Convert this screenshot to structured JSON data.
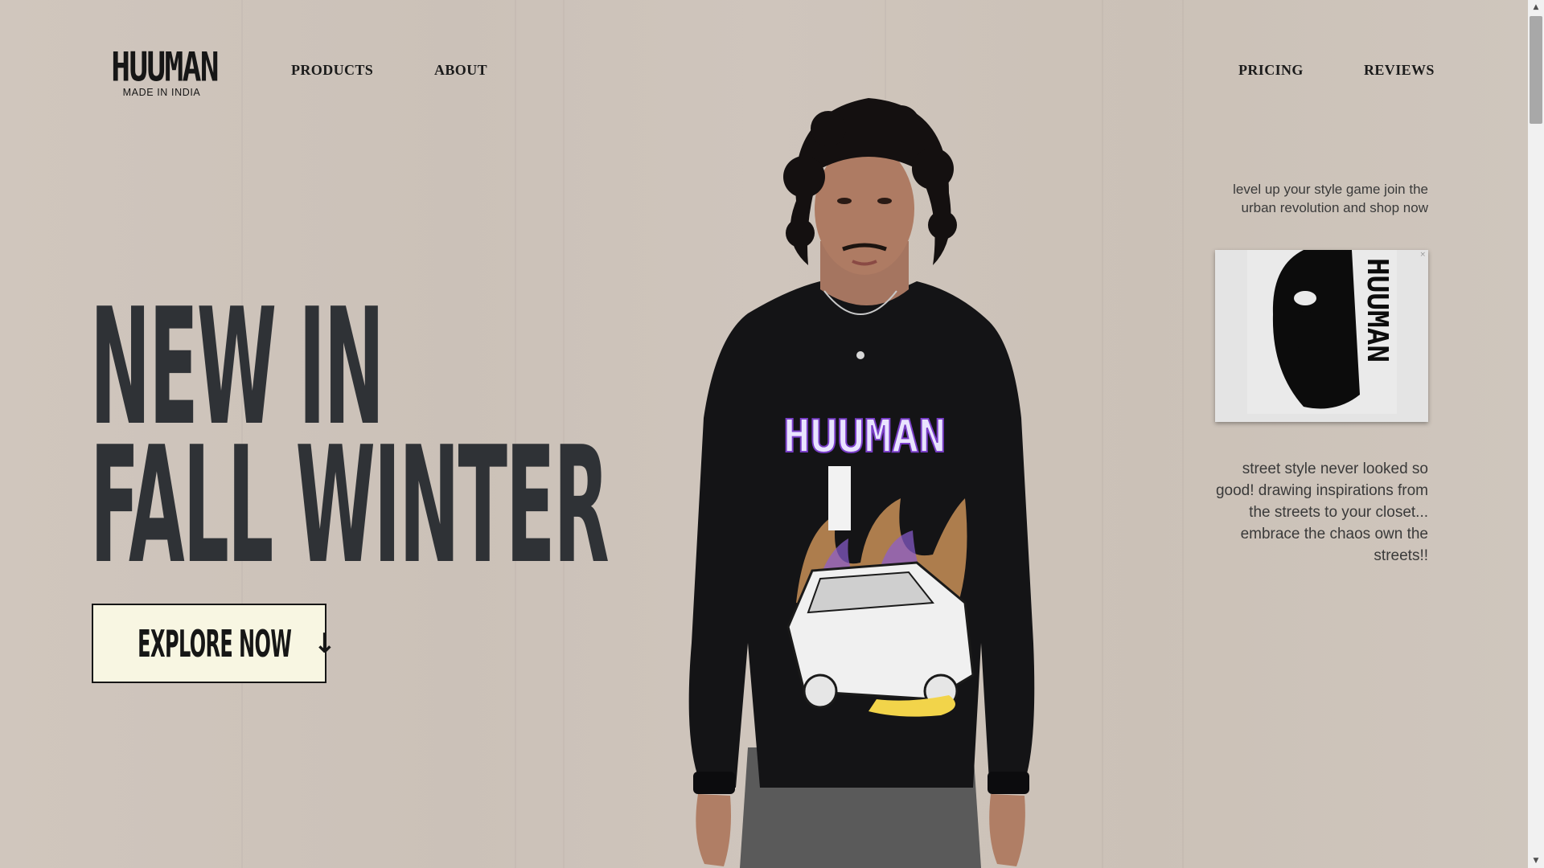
{
  "brand": {
    "name": "HUUMAN",
    "tagline": "MADE IN INDIA"
  },
  "nav": {
    "left": [
      "PRODUCTS",
      "ABOUT"
    ],
    "right": [
      "PRICING",
      "REVIEWS"
    ]
  },
  "hero": {
    "line1": "NEW IN",
    "line2": "FALL WINTER",
    "cta": "EXPLORE NOW",
    "cta_icon": "arrow-down-icon"
  },
  "model": {
    "shirt_print": "HUUMAN"
  },
  "sidebar": {
    "tagline": "level up your style game join the urban revolution and shop now",
    "thumbnail_text": "HUUMAN",
    "description": "street style never looked so good! drawing inspirations from the streets to your closet... embrace the chaos own the streets!!"
  },
  "colors": {
    "background": "#cec4bb",
    "headline": "#2f3236",
    "button_bg": "#f8f6e2",
    "text_dark": "#161616"
  }
}
